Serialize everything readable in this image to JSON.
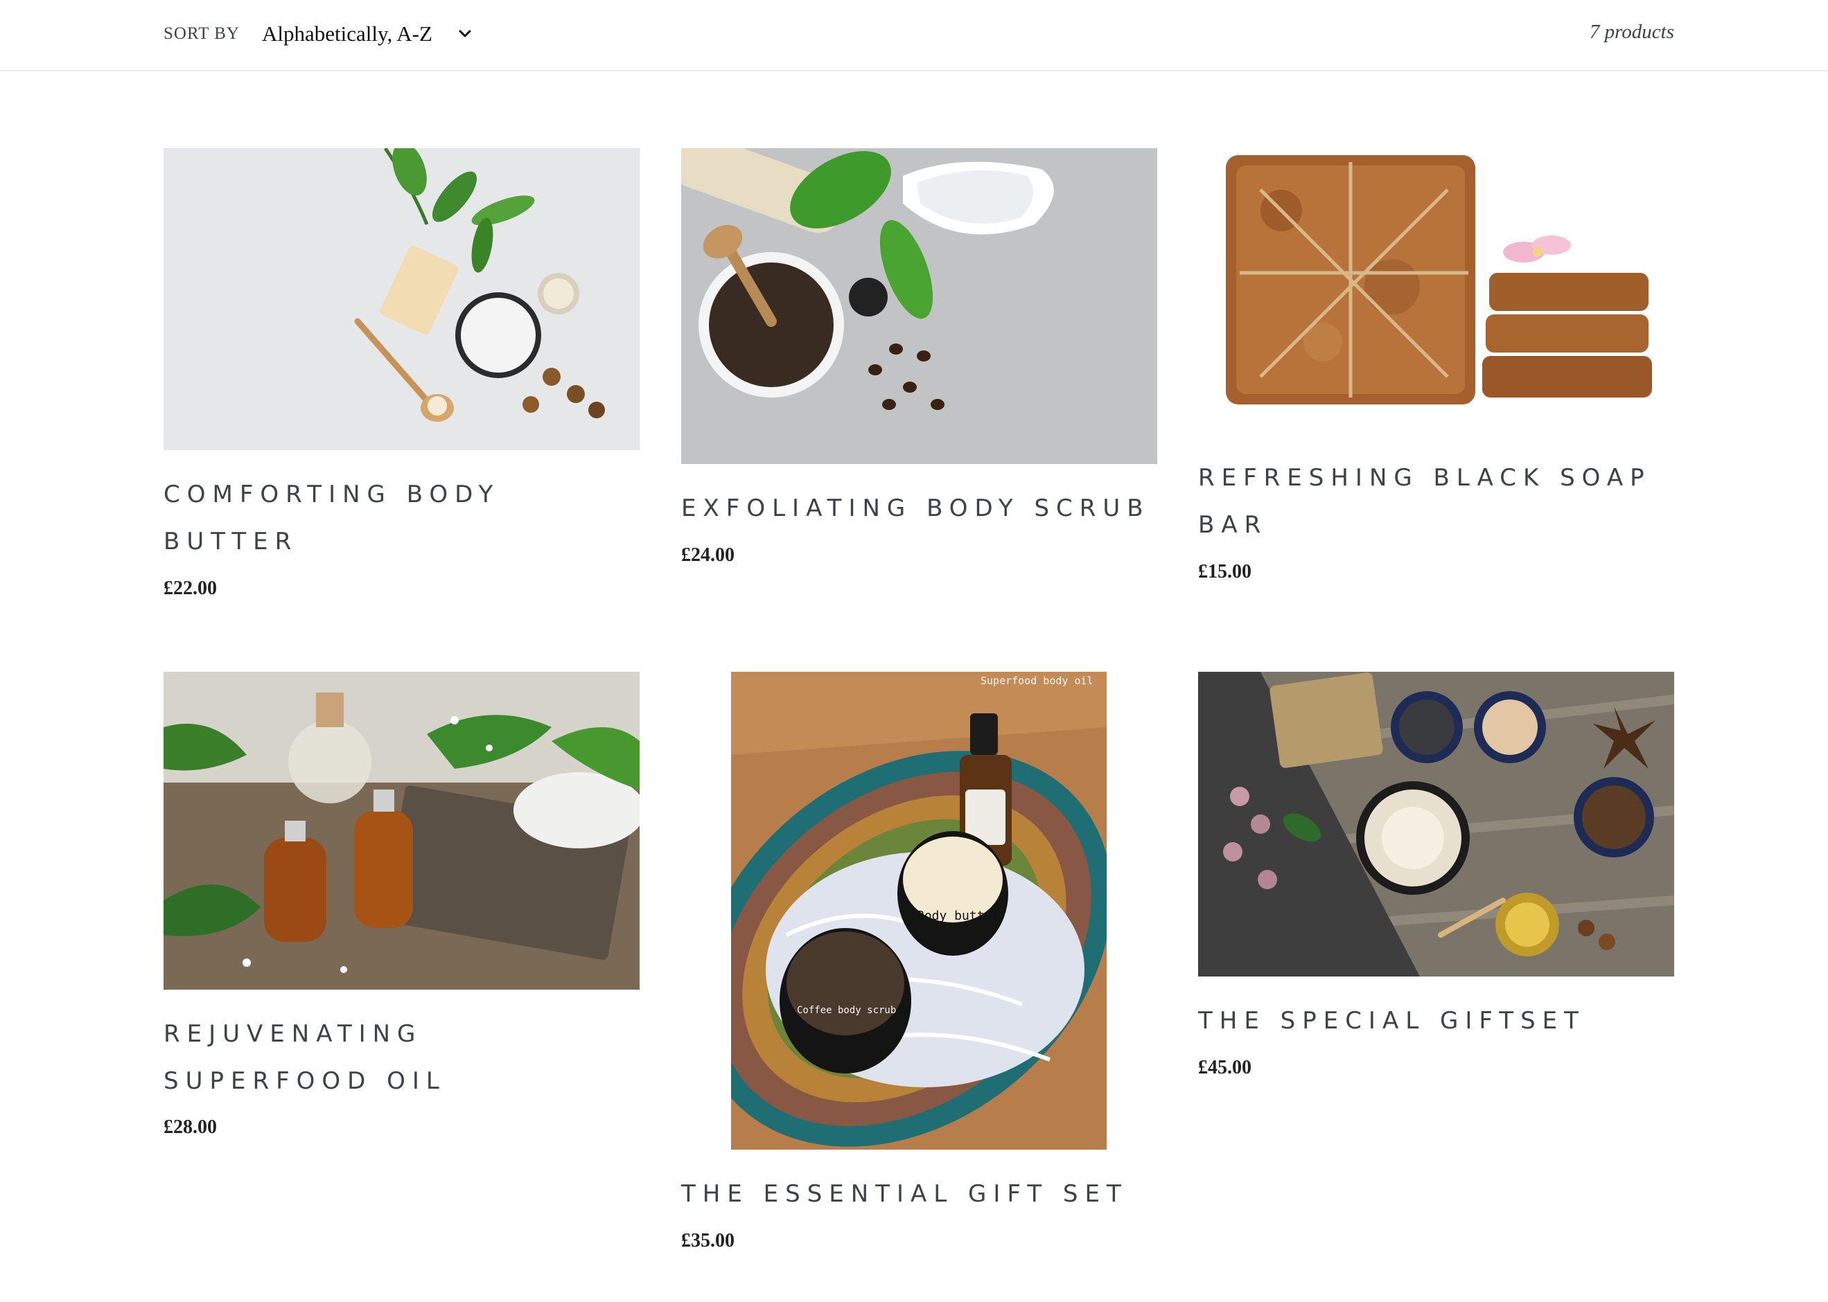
{
  "toolbar": {
    "sort_label": "SORT BY",
    "sort_value": "Alphabetically, A-Z",
    "product_count": "7 products"
  },
  "products": [
    {
      "title": "COMFORTING BODY BUTTER",
      "price": "£22.00",
      "image_icon": "body-butter-photo"
    },
    {
      "title": "EXFOLIATING BODY SCRUB",
      "price": "£24.00",
      "image_icon": "body-scrub-photo"
    },
    {
      "title": "REFRESHING BLACK SOAP BAR",
      "price": "£15.00",
      "image_icon": "black-soap-photo"
    },
    {
      "title": "REJUVENATING SUPERFOOD OIL",
      "price": "£28.00",
      "image_icon": "superfood-oil-photo"
    },
    {
      "title": "THE ESSENTIAL GIFT SET",
      "price": "£35.00",
      "image_icon": "essential-gift-set-photo",
      "image_text": {
        "oil": "Superfood body oil",
        "butter": "Body butter",
        "scrub": "Coffee body scrub"
      }
    },
    {
      "title": "THE SPECIAL GIFTSET",
      "price": "£45.00",
      "image_icon": "special-giftset-photo"
    }
  ],
  "colors": {
    "text": "#3d4246",
    "border": "#e8e9eb",
    "background": "#ffffff"
  }
}
